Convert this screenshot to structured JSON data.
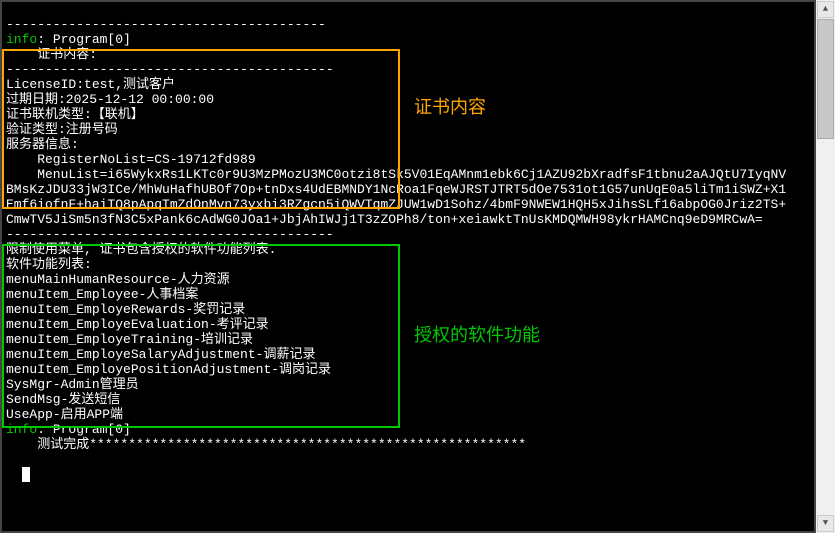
{
  "log": {
    "divider_top": "-----------------------------------------",
    "info_tag": "info",
    "program_header": "Program[0]",
    "license_content_label": "    证书内容:",
    "divider_dashes": "------------------------------------------",
    "license_id": "LicenseID:test,测试客户",
    "expire": "过期日期:2025-12-12 00:00:00",
    "lic_type": "证书联机类型:【联机】",
    "verify_type": "验证类型:注册号码",
    "server_info_label": "服务器信息:",
    "register_no": "    RegisterNoList=CS-19712fd989",
    "menu_list_line1": "    MenuList=i65WykxRs1LKTc0r9U3MzPMozU3MC0otzi8tSk5V01EqAMnm1ebk6Cj1AZU92bXradfsF1tbnu2aAJQtU7IyqNV",
    "menu_list_line2": "BMsKzJDU33jW3ICe/MhWuHafhUBOf7Op+tnDxs4UdEBMNDY1NcRoa1FqeWJRSTJTRT5dOe7531ot1G57unUqE0a5liTm1iSWZ+X1",
    "menu_list_line3": "Emf6iofnF+haiTQ8pApqTmZdOnMvn73yxbi3RZgcn5iQWVTqmZJUW1wD1Sohz/4bmF9NWEW1HQH5xJihsSLf16abpOG0Jriz2TS+",
    "menu_list_line4": "CmwTV5JiSm5n3fN3C5xPank6cAdWG0JOa1+JbjAhIWJj1T3zZOPh8/ton+xeiawktTnUsKMDQMWH98ykrHAMCnq9eD9MRCwA=",
    "restrict_line": "限制使用菜单, 证书包含授权的软件功能列表.",
    "feature_list_label": "软件功能列表:",
    "features": [
      "menuMainHumanResource-人力资源",
      "menuItem_Employee-人事档案",
      "menuItem_EmployeRewards-奖罚记录",
      "menuItem_EmployeEvaluation-考评记录",
      "menuItem_EmployeTraining-培训记录",
      "menuItem_EmployeSalaryAdjustment-调薪记录",
      "menuItem_EmployePositionAdjustment-调岗记录",
      "SysMgr-Admin管理员",
      "SendMsg-发送短信",
      "UseApp-启用APP端"
    ],
    "program_footer": "Program[0]",
    "test_done": "    测试完成********************************************************"
  },
  "annotations": {
    "license_content": "证书内容",
    "authorized_features": "授权的软件功能"
  }
}
